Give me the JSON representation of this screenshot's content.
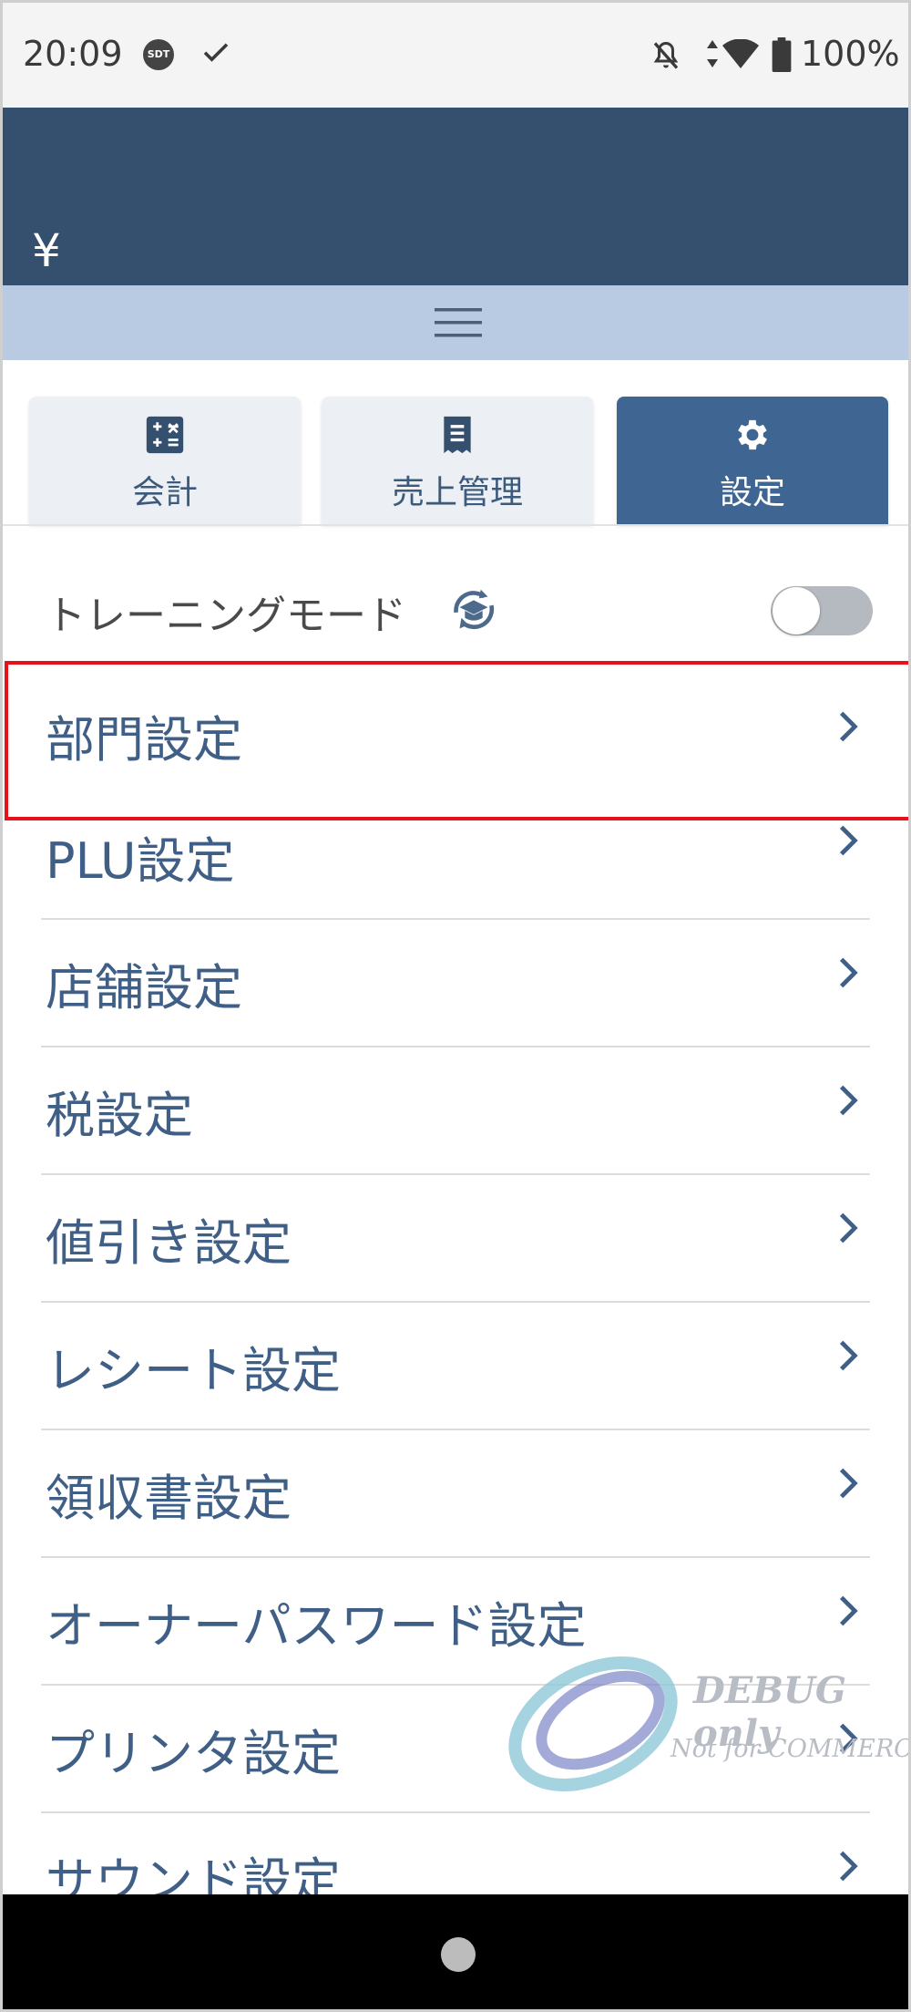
{
  "status_bar": {
    "time": "20:09",
    "sdt_badge": "SDT",
    "battery": "100%"
  },
  "header": {
    "currency_symbol": "¥"
  },
  "tabs": [
    {
      "label": "会計",
      "icon": "calculator-icon",
      "active": false
    },
    {
      "label": "売上管理",
      "icon": "receipt-icon",
      "active": false
    },
    {
      "label": "設定",
      "icon": "gear-icon",
      "active": true
    }
  ],
  "training": {
    "label": "トレーニングモード",
    "enabled": false
  },
  "settings": [
    {
      "label": "部門設定"
    },
    {
      "label": "PLU設定"
    },
    {
      "label": "店舗設定"
    },
    {
      "label": "税設定"
    },
    {
      "label": "値引き設定"
    },
    {
      "label": "レシート設定"
    },
    {
      "label": "領収書設定"
    },
    {
      "label": "オーナーパスワード設定"
    },
    {
      "label": "プリンタ設定"
    },
    {
      "label": "サウンド設定"
    }
  ],
  "watermark": {
    "line1": "DEBUG only",
    "line2": "Not for COMMERCIAL"
  },
  "colors": {
    "header": "#34506e",
    "menu_bar": "#b9cbe3",
    "active_tab": "#3f6592",
    "item_text": "#3f5f86",
    "highlight": "#e8101a"
  }
}
